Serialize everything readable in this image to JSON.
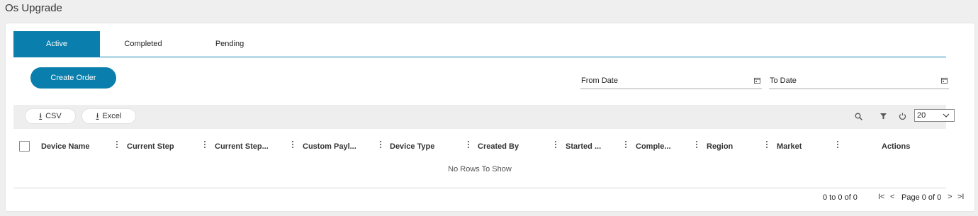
{
  "page": {
    "title": "Os Upgrade"
  },
  "tabs": [
    {
      "label": "Active",
      "active": true
    },
    {
      "label": "Completed",
      "active": false
    },
    {
      "label": "Pending",
      "active": false
    }
  ],
  "actions": {
    "create_order": "Create Order"
  },
  "filters": {
    "from_date": "From Date",
    "to_date": "To Date"
  },
  "toolbar": {
    "csv": "CSV",
    "excel": "Excel",
    "download_glyph": "⭳",
    "page_size": "20",
    "icons": [
      "search-icon",
      "filter-icon",
      "refresh-icon",
      "chevron-down-icon"
    ]
  },
  "grid": {
    "columns": [
      "Device Name",
      "Current Step",
      "Current Step...",
      "Custom Payl...",
      "Device Type",
      "Created By",
      "Started ...",
      "Comple...",
      "Region",
      "Market",
      "Actions"
    ],
    "empty_message": "No Rows To Show",
    "rows": []
  },
  "pagination": {
    "summary": "0 to 0 of 0",
    "page_text": "Page 0 of 0",
    "first": "I<",
    "prev": "<",
    "next": ">",
    "last": ">I"
  },
  "colors": {
    "accent": "#0a7fad",
    "background": "#efefef",
    "toolbar": "#eeeeee"
  }
}
